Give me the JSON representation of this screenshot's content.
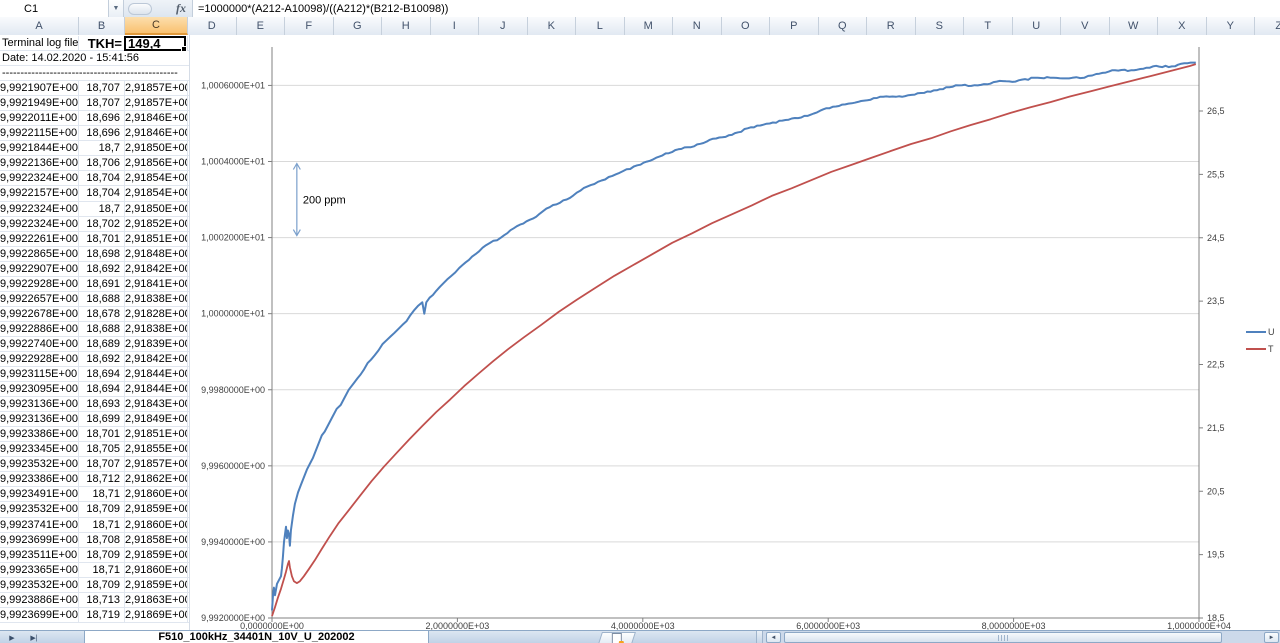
{
  "formula_bar": {
    "cell_ref": "C1",
    "fx_label": "fx",
    "formula": "=1000000*(A212-A10098)/((A212)*(B212-B10098))"
  },
  "columns": {
    "letters": [
      "A",
      "B",
      "C",
      "D",
      "E",
      "F",
      "G",
      "H",
      "I",
      "J",
      "K",
      "L",
      "M",
      "N",
      "O",
      "P",
      "Q",
      "R",
      "S",
      "T",
      "U",
      "V",
      "W",
      "X",
      "Y",
      "Z"
    ],
    "selected": "C"
  },
  "sheet": {
    "row1": {
      "a": "Terminal log file",
      "b": "TKH=",
      "c": "149,4"
    },
    "row2": "Date: 14.02.2020 - 15:41:56",
    "row3": "------------------------------------------------",
    "rows": [
      [
        "9,9921907E+00",
        "18,707",
        "2,91857E+00"
      ],
      [
        "9,9921949E+00",
        "18,707",
        "2,91857E+00"
      ],
      [
        "9,9922011E+00",
        "18,696",
        "2,91846E+00"
      ],
      [
        "9,9922115E+00",
        "18,696",
        "2,91846E+00"
      ],
      [
        "9,9921844E+00",
        "18,7",
        "2,91850E+00"
      ],
      [
        "9,9922136E+00",
        "18,706",
        "2,91856E+00"
      ],
      [
        "9,9922324E+00",
        "18,704",
        "2,91854E+00"
      ],
      [
        "9,9922157E+00",
        "18,704",
        "2,91854E+00"
      ],
      [
        "9,9922324E+00",
        "18,7",
        "2,91850E+00"
      ],
      [
        "9,9922324E+00",
        "18,702",
        "2,91852E+00"
      ],
      [
        "9,9922261E+00",
        "18,701",
        "2,91851E+00"
      ],
      [
        "9,9922865E+00",
        "18,698",
        "2,91848E+00"
      ],
      [
        "9,9922907E+00",
        "18,692",
        "2,91842E+00"
      ],
      [
        "9,9922928E+00",
        "18,691",
        "2,91841E+00"
      ],
      [
        "9,9922657E+00",
        "18,688",
        "2,91838E+00"
      ],
      [
        "9,9922678E+00",
        "18,678",
        "2,91828E+00"
      ],
      [
        "9,9922886E+00",
        "18,688",
        "2,91838E+00"
      ],
      [
        "9,9922740E+00",
        "18,689",
        "2,91839E+00"
      ],
      [
        "9,9922928E+00",
        "18,692",
        "2,91842E+00"
      ],
      [
        "9,9923115E+00",
        "18,694",
        "2,91844E+00"
      ],
      [
        "9,9923095E+00",
        "18,694",
        "2,91844E+00"
      ],
      [
        "9,9923136E+00",
        "18,693",
        "2,91843E+00"
      ],
      [
        "9,9923136E+00",
        "18,699",
        "2,91849E+00"
      ],
      [
        "9,9923386E+00",
        "18,701",
        "2,91851E+00"
      ],
      [
        "9,9923345E+00",
        "18,705",
        "2,91855E+00"
      ],
      [
        "9,9923532E+00",
        "18,707",
        "2,91857E+00"
      ],
      [
        "9,9923386E+00",
        "18,712",
        "2,91862E+00"
      ],
      [
        "9,9923491E+00",
        "18,71",
        "2,91860E+00"
      ],
      [
        "9,9923532E+00",
        "18,709",
        "2,91859E+00"
      ],
      [
        "9,9923741E+00",
        "18,71",
        "2,91860E+00"
      ],
      [
        "9,9923699E+00",
        "18,708",
        "2,91858E+00"
      ],
      [
        "9,9923511E+00",
        "18,709",
        "2,91859E+00"
      ],
      [
        "9,9923365E+00",
        "18,71",
        "2,91860E+00"
      ],
      [
        "9,9923532E+00",
        "18,709",
        "2,91859E+00"
      ],
      [
        "9,9923886E+00",
        "18,713",
        "2,91863E+00"
      ],
      [
        "9,9923699E+00",
        "18,719",
        "2,91869E+00"
      ]
    ]
  },
  "tab_bar": {
    "active_tab": "F510_100kHz_34401N_10V_U_202002"
  },
  "icons": {
    "name_box_dropdown": "▼",
    "tab_scroll_right": "▶",
    "tab_scroll_last": "▶|",
    "scroll_left": "◄",
    "scroll_right": "►"
  },
  "chart_data": {
    "type": "line",
    "x_axis": {
      "range": [
        0,
        10000
      ],
      "tick_values": [
        0,
        2000,
        4000,
        6000,
        8000,
        10000
      ],
      "tick_labels": [
        "0,0000000E+00",
        "2,0000000E+03",
        "4,0000000E+03",
        "6,0000000E+03",
        "8,0000000E+03",
        "1,0000000E+04"
      ]
    },
    "left_axis": {
      "range": [
        9.992,
        10.00701
      ],
      "tick_values": [
        10.006,
        10.004,
        10.002,
        10.0,
        9.998,
        9.996,
        9.994,
        9.992
      ],
      "tick_labels": [
        "1,0006000E+01",
        "1,0004000E+01",
        "1,0002000E+01",
        "1,0000000E+01",
        "9,9980000E+00",
        "9,9960000E+00",
        "9,9940000E+00",
        "9,9920000E+00"
      ],
      "gridlines": true
    },
    "right_axis": {
      "range": [
        18.5,
        27.51
      ],
      "tick_values": [
        26.5,
        25.5,
        24.5,
        23.5,
        22.5,
        21.5,
        20.5,
        19.5,
        18.5
      ],
      "tick_labels": [
        "26,5",
        "25,5",
        "24,5",
        "23,5",
        "22,5",
        "21,5",
        "20,5",
        "19,5",
        "18,5"
      ]
    },
    "annotation": {
      "text": "200 ppm",
      "x_value": 268,
      "from_value": 10.004,
      "to_value": 10.002,
      "color": "#7BA0CC"
    },
    "legend": {
      "position": "right",
      "entries": [
        {
          "label": "U",
          "color": "#4F81BD"
        },
        {
          "label": "T",
          "color": "#C0504D"
        }
      ]
    },
    "series": [
      {
        "name": "U",
        "color": "#4F81BD",
        "axis": "left",
        "noisy": true,
        "points": [
          [
            0,
            9.9922
          ],
          [
            11,
            9.9926
          ],
          [
            21,
            9.9928
          ],
          [
            32,
            9.9926
          ],
          [
            54,
            9.9929
          ],
          [
            97,
            9.9931
          ],
          [
            107,
            9.9933
          ],
          [
            118,
            9.9936
          ],
          [
            129,
            9.994
          ],
          [
            140,
            9.9942
          ],
          [
            151,
            9.9944
          ],
          [
            161,
            9.9941
          ],
          [
            172,
            9.9943
          ],
          [
            183,
            9.9942
          ],
          [
            193,
            9.9939
          ],
          [
            204,
            9.9943
          ],
          [
            226,
            9.9947
          ],
          [
            247,
            9.995
          ],
          [
            280,
            9.9953
          ],
          [
            312,
            9.9955
          ],
          [
            344,
            9.9957
          ],
          [
            376,
            9.9959
          ],
          [
            419,
            9.9961
          ],
          [
            440,
            9.9962
          ],
          [
            473,
            9.9964
          ],
          [
            505,
            9.9966
          ],
          [
            537,
            9.9968
          ],
          [
            569,
            9.9969
          ],
          [
            612,
            9.9971
          ],
          [
            655,
            9.9973
          ],
          [
            698,
            9.9975
          ],
          [
            741,
            9.9976
          ],
          [
            784,
            9.9978
          ],
          [
            827,
            9.998
          ],
          [
            891,
            9.9982
          ],
          [
            956,
            9.9984
          ],
          [
            1031,
            9.9987
          ],
          [
            1106,
            9.9989
          ],
          [
            1192,
            9.9992
          ],
          [
            1278,
            9.9994
          ],
          [
            1364,
            9.9996
          ],
          [
            1450,
            9.9998
          ],
          [
            1536,
            10.0001
          ],
          [
            1621,
            10.0003
          ],
          [
            1643,
            10.0
          ],
          [
            1664,
            10.0003
          ],
          [
            1772,
            10.0006
          ],
          [
            1890,
            10.0009
          ],
          [
            2019,
            10.0012
          ],
          [
            2159,
            10.0015
          ],
          [
            2309,
            10.0018
          ],
          [
            2470,
            10.002
          ],
          [
            2642,
            10.0023
          ],
          [
            2814,
            10.0025
          ],
          [
            2996,
            10.0028
          ],
          [
            3179,
            10.003
          ],
          [
            3361,
            10.0033
          ],
          [
            3555,
            10.0035
          ],
          [
            3748,
            10.0037
          ],
          [
            3941,
            10.0039
          ],
          [
            4145,
            10.0041
          ],
          [
            4349,
            10.0043
          ],
          [
            4553,
            10.0044
          ],
          [
            4757,
            10.0046
          ],
          [
            4961,
            10.0047
          ],
          [
            5165,
            10.0049
          ],
          [
            5369,
            10.005
          ],
          [
            5573,
            10.0051
          ],
          [
            5777,
            10.0052
          ],
          [
            5981,
            10.0054
          ],
          [
            6185,
            10.0055
          ],
          [
            6389,
            10.0056
          ],
          [
            6593,
            10.0057
          ],
          [
            6797,
            10.0057
          ],
          [
            7001,
            10.0058
          ],
          [
            7205,
            10.0059
          ],
          [
            7409,
            10.006
          ],
          [
            7613,
            10.006
          ],
          [
            7817,
            10.0061
          ],
          [
            8021,
            10.0061
          ],
          [
            8225,
            10.0062
          ],
          [
            8429,
            10.0062
          ],
          [
            8633,
            10.0062
          ],
          [
            8762,
            10.0062
          ],
          [
            8891,
            10.0063
          ],
          [
            9095,
            10.0064
          ],
          [
            9299,
            10.0064
          ],
          [
            9503,
            10.0065
          ],
          [
            9707,
            10.0065
          ],
          [
            9911,
            10.0066
          ],
          [
            9965,
            10.0066
          ]
        ]
      },
      {
        "name": "T",
        "color": "#C0504D",
        "axis": "right",
        "noisy": false,
        "points": [
          [
            0,
            18.53
          ],
          [
            32,
            18.67
          ],
          [
            64,
            18.82
          ],
          [
            97,
            18.96
          ],
          [
            129,
            19.12
          ],
          [
            151,
            19.23
          ],
          [
            172,
            19.35
          ],
          [
            183,
            19.4
          ],
          [
            193,
            19.3
          ],
          [
            215,
            19.16
          ],
          [
            236,
            19.08
          ],
          [
            269,
            19.05
          ],
          [
            301,
            19.08
          ],
          [
            344,
            19.16
          ],
          [
            397,
            19.27
          ],
          [
            462,
            19.41
          ],
          [
            537,
            19.59
          ],
          [
            623,
            19.79
          ],
          [
            720,
            20.0
          ],
          [
            827,
            20.2
          ],
          [
            945,
            20.42
          ],
          [
            1074,
            20.66
          ],
          [
            1203,
            20.88
          ],
          [
            1342,
            21.1
          ],
          [
            1482,
            21.32
          ],
          [
            1621,
            21.53
          ],
          [
            1772,
            21.75
          ],
          [
            1922,
            21.95
          ],
          [
            2073,
            22.16
          ],
          [
            2223,
            22.35
          ],
          [
            2384,
            22.55
          ],
          [
            2545,
            22.74
          ],
          [
            2717,
            22.93
          ],
          [
            2900,
            23.12
          ],
          [
            3093,
            23.33
          ],
          [
            3286,
            23.52
          ],
          [
            3490,
            23.71
          ],
          [
            3694,
            23.9
          ],
          [
            3898,
            24.07
          ],
          [
            4102,
            24.24
          ],
          [
            4317,
            24.42
          ],
          [
            4532,
            24.57
          ],
          [
            4746,
            24.73
          ],
          [
            4961,
            24.87
          ],
          [
            5176,
            25.01
          ],
          [
            5391,
            25.16
          ],
          [
            5605,
            25.28
          ],
          [
            5820,
            25.41
          ],
          [
            6035,
            25.54
          ],
          [
            6250,
            25.65
          ],
          [
            6464,
            25.76
          ],
          [
            6679,
            25.87
          ],
          [
            6894,
            25.98
          ],
          [
            7109,
            26.07
          ],
          [
            7323,
            26.18
          ],
          [
            7538,
            26.28
          ],
          [
            7753,
            26.37
          ],
          [
            7968,
            26.47
          ],
          [
            8182,
            26.56
          ],
          [
            8397,
            26.64
          ],
          [
            8612,
            26.73
          ],
          [
            8827,
            26.81
          ],
          [
            9041,
            26.89
          ],
          [
            9256,
            26.97
          ],
          [
            9471,
            27.05
          ],
          [
            9686,
            27.13
          ],
          [
            9901,
            27.21
          ],
          [
            9965,
            27.24
          ]
        ]
      }
    ]
  }
}
